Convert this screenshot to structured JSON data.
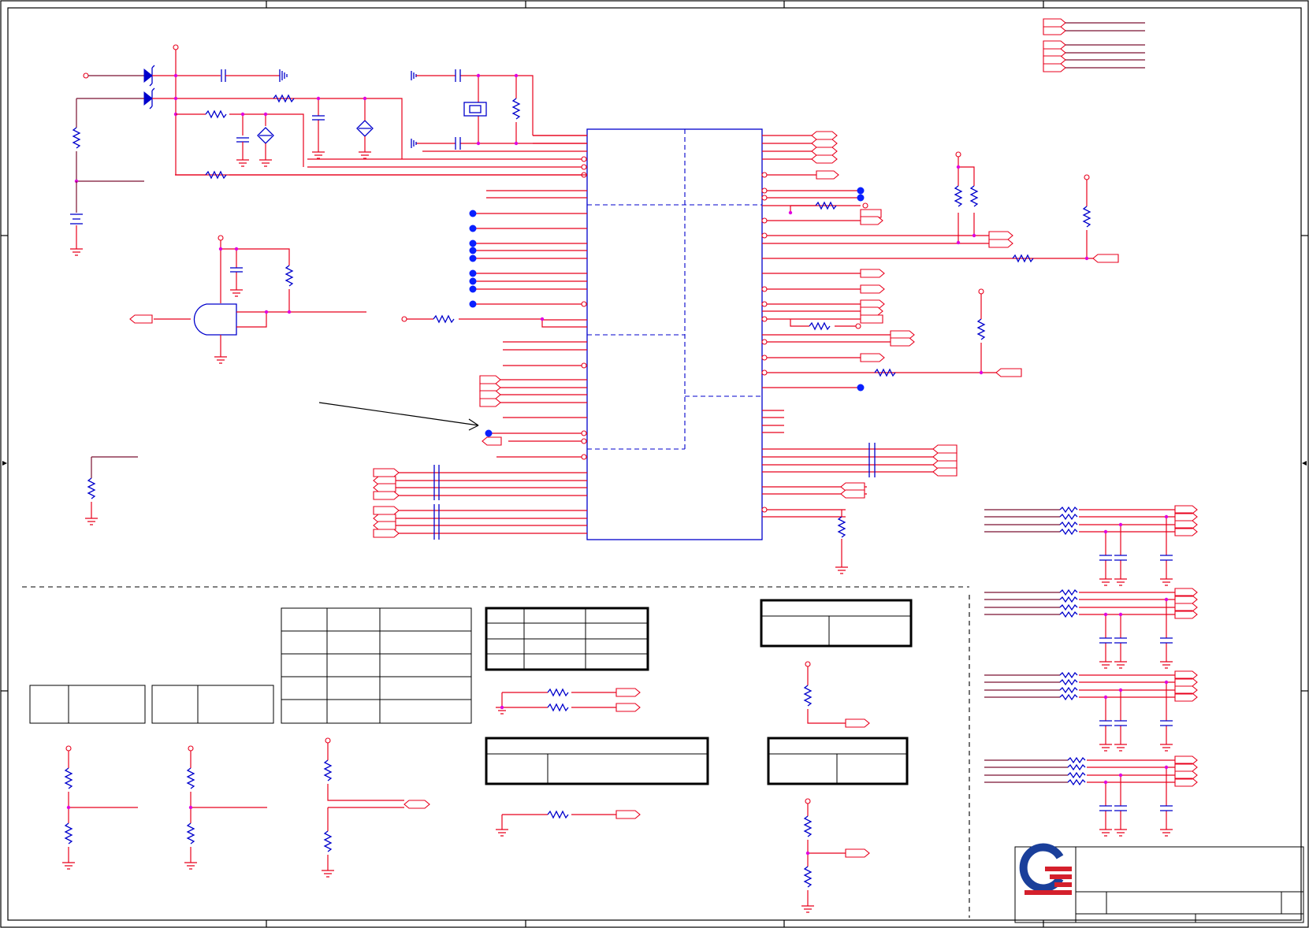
{
  "sheet": {
    "title": "",
    "notes": []
  },
  "title_block": {
    "logo": "company-logo",
    "colors": {
      "logo_blue": "#1a3f9a",
      "logo_red": "#d4202c"
    }
  },
  "colors": {
    "wire": "#e8001c",
    "net": "#7a1030",
    "component": "#0000cc",
    "junction": "#e000e0",
    "no_connect": "#0a20ff"
  }
}
